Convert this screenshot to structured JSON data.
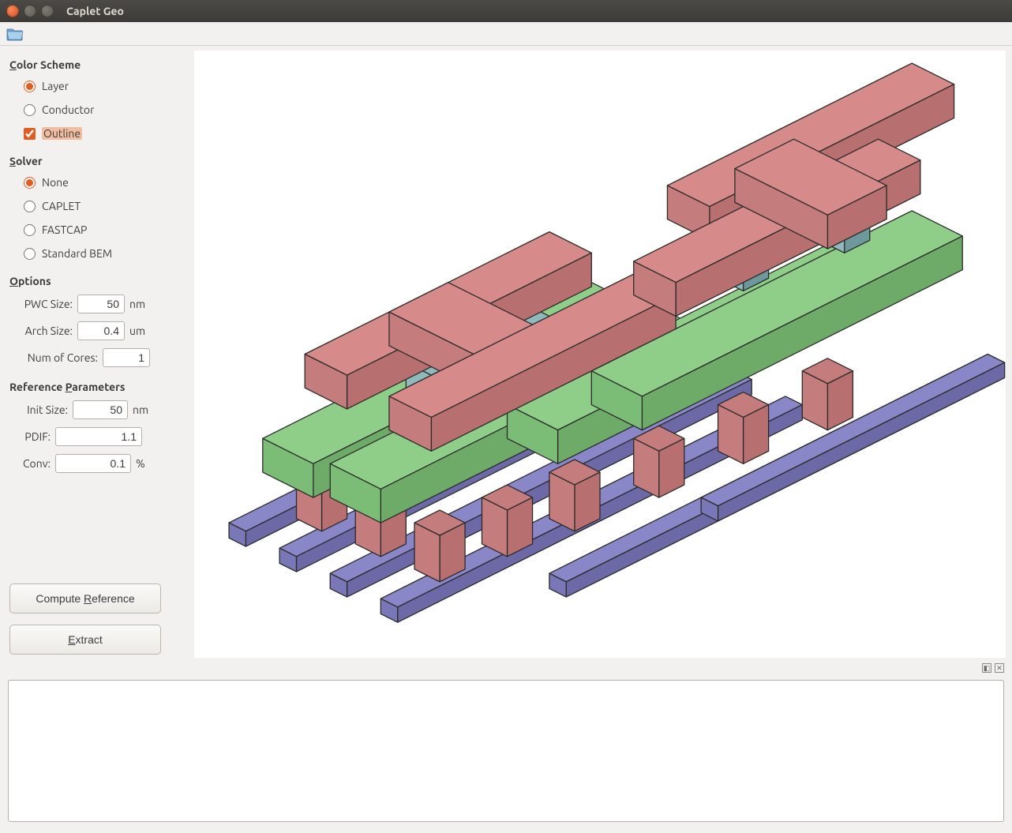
{
  "window": {
    "title": "Caplet Geo"
  },
  "sidebar": {
    "color_scheme": {
      "title": "Color Scheme",
      "layer": "Layer",
      "conductor": "Conductor",
      "outline": "Outline"
    },
    "solver": {
      "title": "Solver",
      "none": "None",
      "caplet": "CAPLET",
      "fastcap": "FASTCAP",
      "standard_bem": "Standard BEM"
    },
    "options": {
      "title": "Options",
      "pwc_label": "PWC Size:",
      "pwc_value": "50",
      "pwc_unit": "nm",
      "arch_label": "Arch Size:",
      "arch_value": "0.4",
      "arch_unit": "um",
      "cores_label": "Num of Cores:",
      "cores_value": "1"
    },
    "ref_params": {
      "title": "Reference Parameters",
      "init_label": "Init Size:",
      "init_value": "50",
      "init_unit": "nm",
      "pdif_label": "PDIF:",
      "pdif_value": "1.1",
      "conv_label": "Conv:",
      "conv_value": "0.1",
      "conv_unit": "%"
    },
    "buttons": {
      "compute_ref_prefix": "Compute ",
      "compute_ref_u": "R",
      "compute_ref_suffix": "eference",
      "extract_u": "E",
      "extract_suffix": "xtract"
    }
  },
  "colors": {
    "red_top": "#d68a8a",
    "red_side": "#b86f6f",
    "red_front": "#c57c7c",
    "green_top": "#8fce89",
    "green_side": "#6eab69",
    "green_front": "#7bbd76",
    "teal_top": "#8fb9bb",
    "teal_side": "#6d999c",
    "purple_top": "#8a87c8",
    "purple_side": "#6c69a6",
    "purple_front": "#7a77b8",
    "outline": "#2a2a2a"
  }
}
